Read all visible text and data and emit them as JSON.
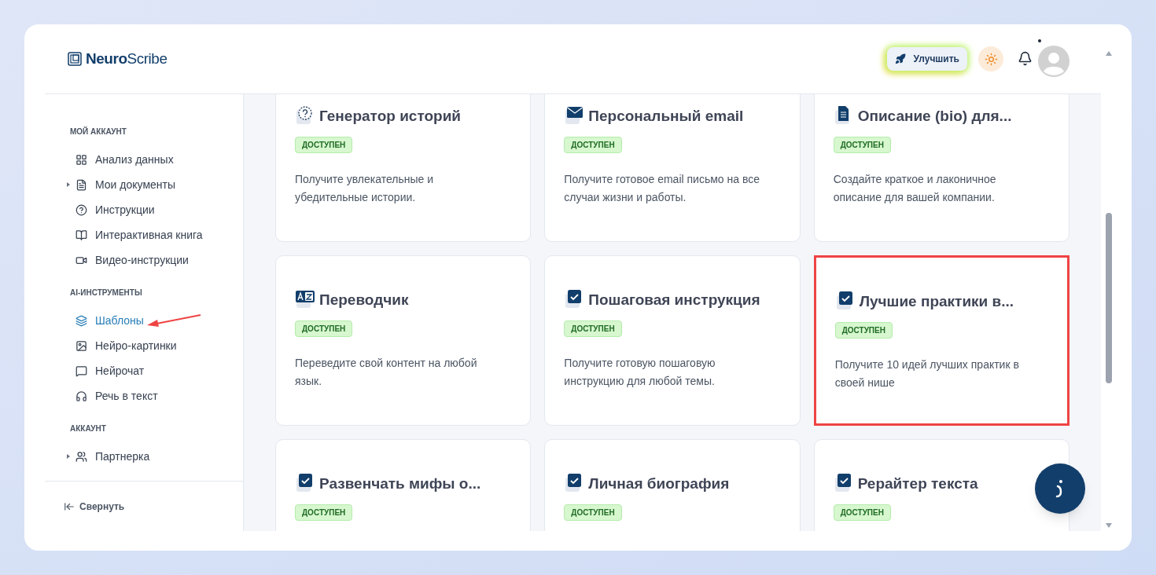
{
  "logo": {
    "bold": "Neuro",
    "rest": "Scribe"
  },
  "header": {
    "upgrade_button": "Улучшить",
    "notification_dot": true
  },
  "sidebar": {
    "sections": [
      {
        "title": "МОЙ АККАУНТ",
        "items": [
          {
            "label": "Анализ данных",
            "selected": false,
            "expandable": false
          },
          {
            "label": "Мои документы",
            "selected": false,
            "expandable": true
          },
          {
            "label": "Инструкции",
            "selected": false,
            "expandable": false
          },
          {
            "label": "Интерактивная книга",
            "selected": false,
            "expandable": false
          },
          {
            "label": "Видео-инструкции",
            "selected": false,
            "expandable": false
          }
        ]
      },
      {
        "title": "AI-ИНСТРУМЕНТЫ",
        "items": [
          {
            "label": "Шаблоны",
            "selected": true,
            "expandable": false
          },
          {
            "label": "Нейро-картинки",
            "selected": false,
            "expandable": false
          },
          {
            "label": "Нейрочат",
            "selected": false,
            "expandable": false
          },
          {
            "label": "Речь в текст",
            "selected": false,
            "expandable": false
          }
        ]
      },
      {
        "title": "АККАУНТ",
        "items": [
          {
            "label": "Партнерка",
            "selected": false,
            "expandable": true
          }
        ]
      }
    ],
    "collapse": "Свернуть"
  },
  "cards": [
    {
      "title": "Генератор историй",
      "badge": "ДОСТУПЕН",
      "description": "Получите увлекательные и убедительные истории.",
      "highlighted": false
    },
    {
      "title": "Персональный email",
      "badge": "ДОСТУПЕН",
      "description": "Получите готовое email письмо на все случаи жизни и работы.",
      "highlighted": false
    },
    {
      "title": "Описание (bio) для...",
      "badge": "ДОСТУПЕН",
      "description": "Создайте краткое и лаконичное описание для вашей компании.",
      "highlighted": false
    },
    {
      "title": "Переводчик",
      "badge": "ДОСТУПЕН",
      "description": "Переведите свой контент на любой язык.",
      "highlighted": false
    },
    {
      "title": "Пошаговая инструкция",
      "badge": "ДОСТУПЕН",
      "description": "Получите готовую пошаговую инструкцию для любой темы.",
      "highlighted": false
    },
    {
      "title": "Лучшие практики в...",
      "badge": "ДОСТУПЕН",
      "description": "Получите 10 идей лучших практик в своей нише",
      "highlighted": true
    },
    {
      "title": "Развенчать мифы о...",
      "badge": "ДОСТУПЕН",
      "highlighted": false
    },
    {
      "title": "Личная биография",
      "badge": "ДОСТУПЕН",
      "highlighted": false
    },
    {
      "title": "Рерайтер текста",
      "badge": "ДОСТУПЕН",
      "highlighted": false
    }
  ]
}
